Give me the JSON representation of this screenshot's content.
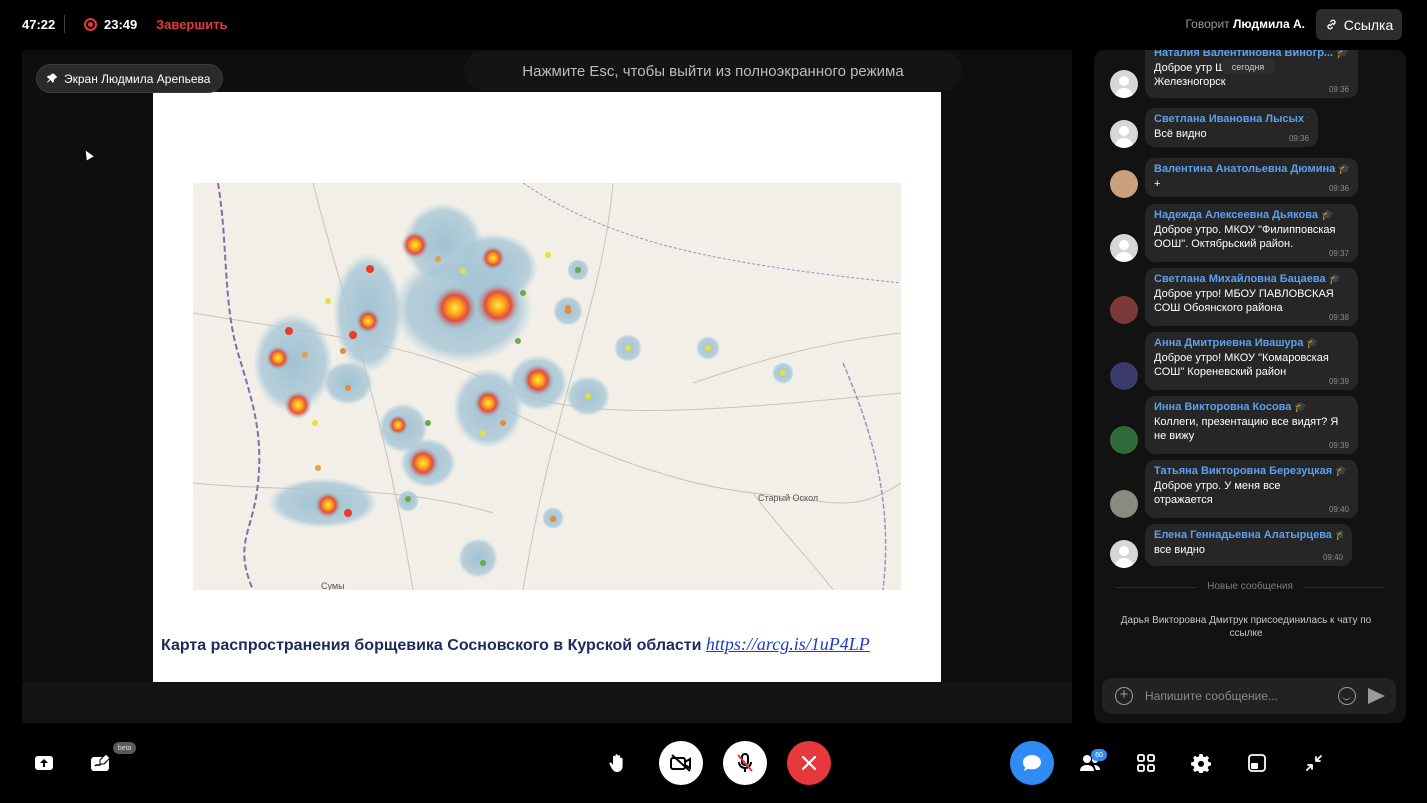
{
  "topbar": {
    "elapsed": "47:22",
    "rec_time": "23:49",
    "finish_label": "Завершить",
    "speaking_prefix": "Говорит",
    "speaking_name": "Людмила А.",
    "link_label": "Ссылка"
  },
  "stage": {
    "screen_label": "Экран Людмила Арепьева",
    "esc_hint": "Нажмите Esc, чтобы выйти из полноэкранного режима",
    "slide": {
      "caption_text": "Карта распространения борщевика Сосновского в Курской области",
      "caption_link": "https://arcg.is/1uP4LP",
      "map_labels": {
        "city_east": "Старый Оскол",
        "city_south": "Сумы"
      }
    }
  },
  "chat": {
    "today_label": "сегодня",
    "messages": [
      {
        "name": "Наталия Валентиновна Виногр...",
        "text": "Доброе утр      Ш 8 г. Железногорск",
        "time": "09:36"
      },
      {
        "name": "Светлана Ивановна Лысых",
        "text": "Всё видно",
        "time": "09:36"
      },
      {
        "name": "Валентина Анатольевна Дюмина",
        "text": "+",
        "time": "09:36"
      },
      {
        "name": "Надежда Алексеевна Дьякова",
        "text": "Доброе утро. МКОУ \"Филипповская ООШ\". Октябрьский район.",
        "time": "09:37"
      },
      {
        "name": "Светлана Михайловна Бацаева",
        "text": "Доброе утро! МБОУ ПАВЛОВСКАЯ СОШ Обоянского района",
        "time": "09:38"
      },
      {
        "name": "Анна Дмитриевна Ивашура",
        "text": "Доброе утро! МКОУ \"Комаровская СОШ\" Кореневский район",
        "time": "09:39"
      },
      {
        "name": "Инна Викторовна Косова",
        "text": "Коллеги, презентацию все видят? Я не вижу",
        "time": "09:39"
      },
      {
        "name": "Татьяна Викторовна Березуцкая",
        "text": "Доброе утро. У меня все отражается",
        "time": "09:40"
      },
      {
        "name": "Елена Геннадьевна Алатырцева",
        "text": "все видно",
        "time": "09:40"
      }
    ],
    "new_messages_label": "Новые сообщения",
    "system_message": "Дарья Викторовна Дмитрук присоединилась к чату по ссылке",
    "input_placeholder": "Напишите сообщение..."
  },
  "bottombar": {
    "beta_label": "beta",
    "participants_count": "60"
  },
  "colors": {
    "accent_blue": "#2f8cf2",
    "danger_red": "#e5393b",
    "name_blue": "#5aa0ee"
  }
}
